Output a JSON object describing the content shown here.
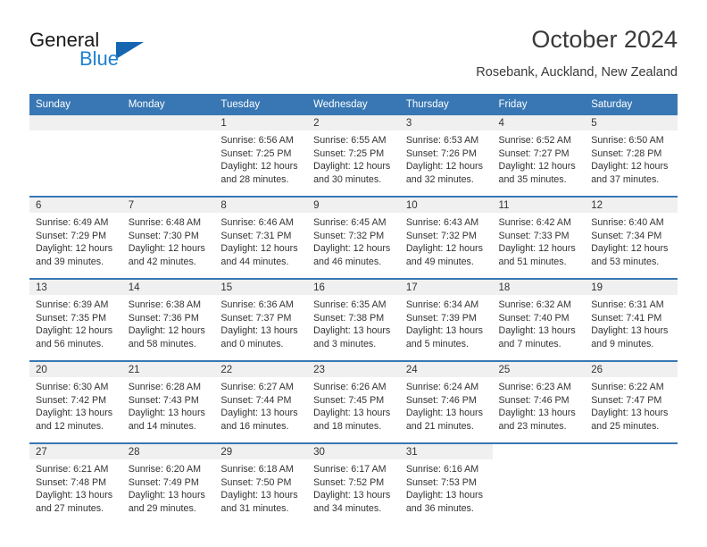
{
  "logo": {
    "word_top": "General",
    "word_bottom": "Blue",
    "triangle_color": "#1565b0",
    "blue_color": "#1f7fd0"
  },
  "header": {
    "title": "October 2024",
    "subtitle": "Rosebank, Auckland, New Zealand"
  },
  "theme": {
    "header_blue": "#3877b4",
    "day_band_gray": "#f0f0f0",
    "text": "#333333"
  },
  "calendar": {
    "weekday_headers": [
      "Sunday",
      "Monday",
      "Tuesday",
      "Wednesday",
      "Thursday",
      "Friday",
      "Saturday"
    ],
    "weeks": [
      [
        {
          "day": "",
          "empty": true,
          "sunrise": "",
          "sunset": "",
          "daylight_1": "",
          "daylight_2": ""
        },
        {
          "day": "",
          "empty": true,
          "sunrise": "",
          "sunset": "",
          "daylight_1": "",
          "daylight_2": ""
        },
        {
          "day": "1",
          "sunrise": "Sunrise: 6:56 AM",
          "sunset": "Sunset: 7:25 PM",
          "daylight_1": "Daylight: 12 hours",
          "daylight_2": "and 28 minutes."
        },
        {
          "day": "2",
          "sunrise": "Sunrise: 6:55 AM",
          "sunset": "Sunset: 7:25 PM",
          "daylight_1": "Daylight: 12 hours",
          "daylight_2": "and 30 minutes."
        },
        {
          "day": "3",
          "sunrise": "Sunrise: 6:53 AM",
          "sunset": "Sunset: 7:26 PM",
          "daylight_1": "Daylight: 12 hours",
          "daylight_2": "and 32 minutes."
        },
        {
          "day": "4",
          "sunrise": "Sunrise: 6:52 AM",
          "sunset": "Sunset: 7:27 PM",
          "daylight_1": "Daylight: 12 hours",
          "daylight_2": "and 35 minutes."
        },
        {
          "day": "5",
          "sunrise": "Sunrise: 6:50 AM",
          "sunset": "Sunset: 7:28 PM",
          "daylight_1": "Daylight: 12 hours",
          "daylight_2": "and 37 minutes."
        }
      ],
      [
        {
          "day": "6",
          "sunrise": "Sunrise: 6:49 AM",
          "sunset": "Sunset: 7:29 PM",
          "daylight_1": "Daylight: 12 hours",
          "daylight_2": "and 39 minutes."
        },
        {
          "day": "7",
          "sunrise": "Sunrise: 6:48 AM",
          "sunset": "Sunset: 7:30 PM",
          "daylight_1": "Daylight: 12 hours",
          "daylight_2": "and 42 minutes."
        },
        {
          "day": "8",
          "sunrise": "Sunrise: 6:46 AM",
          "sunset": "Sunset: 7:31 PM",
          "daylight_1": "Daylight: 12 hours",
          "daylight_2": "and 44 minutes."
        },
        {
          "day": "9",
          "sunrise": "Sunrise: 6:45 AM",
          "sunset": "Sunset: 7:32 PM",
          "daylight_1": "Daylight: 12 hours",
          "daylight_2": "and 46 minutes."
        },
        {
          "day": "10",
          "sunrise": "Sunrise: 6:43 AM",
          "sunset": "Sunset: 7:32 PM",
          "daylight_1": "Daylight: 12 hours",
          "daylight_2": "and 49 minutes."
        },
        {
          "day": "11",
          "sunrise": "Sunrise: 6:42 AM",
          "sunset": "Sunset: 7:33 PM",
          "daylight_1": "Daylight: 12 hours",
          "daylight_2": "and 51 minutes."
        },
        {
          "day": "12",
          "sunrise": "Sunrise: 6:40 AM",
          "sunset": "Sunset: 7:34 PM",
          "daylight_1": "Daylight: 12 hours",
          "daylight_2": "and 53 minutes."
        }
      ],
      [
        {
          "day": "13",
          "sunrise": "Sunrise: 6:39 AM",
          "sunset": "Sunset: 7:35 PM",
          "daylight_1": "Daylight: 12 hours",
          "daylight_2": "and 56 minutes."
        },
        {
          "day": "14",
          "sunrise": "Sunrise: 6:38 AM",
          "sunset": "Sunset: 7:36 PM",
          "daylight_1": "Daylight: 12 hours",
          "daylight_2": "and 58 minutes."
        },
        {
          "day": "15",
          "sunrise": "Sunrise: 6:36 AM",
          "sunset": "Sunset: 7:37 PM",
          "daylight_1": "Daylight: 13 hours",
          "daylight_2": "and 0 minutes."
        },
        {
          "day": "16",
          "sunrise": "Sunrise: 6:35 AM",
          "sunset": "Sunset: 7:38 PM",
          "daylight_1": "Daylight: 13 hours",
          "daylight_2": "and 3 minutes."
        },
        {
          "day": "17",
          "sunrise": "Sunrise: 6:34 AM",
          "sunset": "Sunset: 7:39 PM",
          "daylight_1": "Daylight: 13 hours",
          "daylight_2": "and 5 minutes."
        },
        {
          "day": "18",
          "sunrise": "Sunrise: 6:32 AM",
          "sunset": "Sunset: 7:40 PM",
          "daylight_1": "Daylight: 13 hours",
          "daylight_2": "and 7 minutes."
        },
        {
          "day": "19",
          "sunrise": "Sunrise: 6:31 AM",
          "sunset": "Sunset: 7:41 PM",
          "daylight_1": "Daylight: 13 hours",
          "daylight_2": "and 9 minutes."
        }
      ],
      [
        {
          "day": "20",
          "sunrise": "Sunrise: 6:30 AM",
          "sunset": "Sunset: 7:42 PM",
          "daylight_1": "Daylight: 13 hours",
          "daylight_2": "and 12 minutes."
        },
        {
          "day": "21",
          "sunrise": "Sunrise: 6:28 AM",
          "sunset": "Sunset: 7:43 PM",
          "daylight_1": "Daylight: 13 hours",
          "daylight_2": "and 14 minutes."
        },
        {
          "day": "22",
          "sunrise": "Sunrise: 6:27 AM",
          "sunset": "Sunset: 7:44 PM",
          "daylight_1": "Daylight: 13 hours",
          "daylight_2": "and 16 minutes."
        },
        {
          "day": "23",
          "sunrise": "Sunrise: 6:26 AM",
          "sunset": "Sunset: 7:45 PM",
          "daylight_1": "Daylight: 13 hours",
          "daylight_2": "and 18 minutes."
        },
        {
          "day": "24",
          "sunrise": "Sunrise: 6:24 AM",
          "sunset": "Sunset: 7:46 PM",
          "daylight_1": "Daylight: 13 hours",
          "daylight_2": "and 21 minutes."
        },
        {
          "day": "25",
          "sunrise": "Sunrise: 6:23 AM",
          "sunset": "Sunset: 7:46 PM",
          "daylight_1": "Daylight: 13 hours",
          "daylight_2": "and 23 minutes."
        },
        {
          "day": "26",
          "sunrise": "Sunrise: 6:22 AM",
          "sunset": "Sunset: 7:47 PM",
          "daylight_1": "Daylight: 13 hours",
          "daylight_2": "and 25 minutes."
        }
      ],
      [
        {
          "day": "27",
          "sunrise": "Sunrise: 6:21 AM",
          "sunset": "Sunset: 7:48 PM",
          "daylight_1": "Daylight: 13 hours",
          "daylight_2": "and 27 minutes."
        },
        {
          "day": "28",
          "sunrise": "Sunrise: 6:20 AM",
          "sunset": "Sunset: 7:49 PM",
          "daylight_1": "Daylight: 13 hours",
          "daylight_2": "and 29 minutes."
        },
        {
          "day": "29",
          "sunrise": "Sunrise: 6:18 AM",
          "sunset": "Sunset: 7:50 PM",
          "daylight_1": "Daylight: 13 hours",
          "daylight_2": "and 31 minutes."
        },
        {
          "day": "30",
          "sunrise": "Sunrise: 6:17 AM",
          "sunset": "Sunset: 7:52 PM",
          "daylight_1": "Daylight: 13 hours",
          "daylight_2": "and 34 minutes."
        },
        {
          "day": "31",
          "sunrise": "Sunrise: 6:16 AM",
          "sunset": "Sunset: 7:53 PM",
          "daylight_1": "Daylight: 13 hours",
          "daylight_2": "and 36 minutes."
        },
        {
          "day": "",
          "blank": true,
          "sunrise": "",
          "sunset": "",
          "daylight_1": "",
          "daylight_2": ""
        },
        {
          "day": "",
          "blank": true,
          "sunrise": "",
          "sunset": "",
          "daylight_1": "",
          "daylight_2": ""
        }
      ]
    ]
  }
}
